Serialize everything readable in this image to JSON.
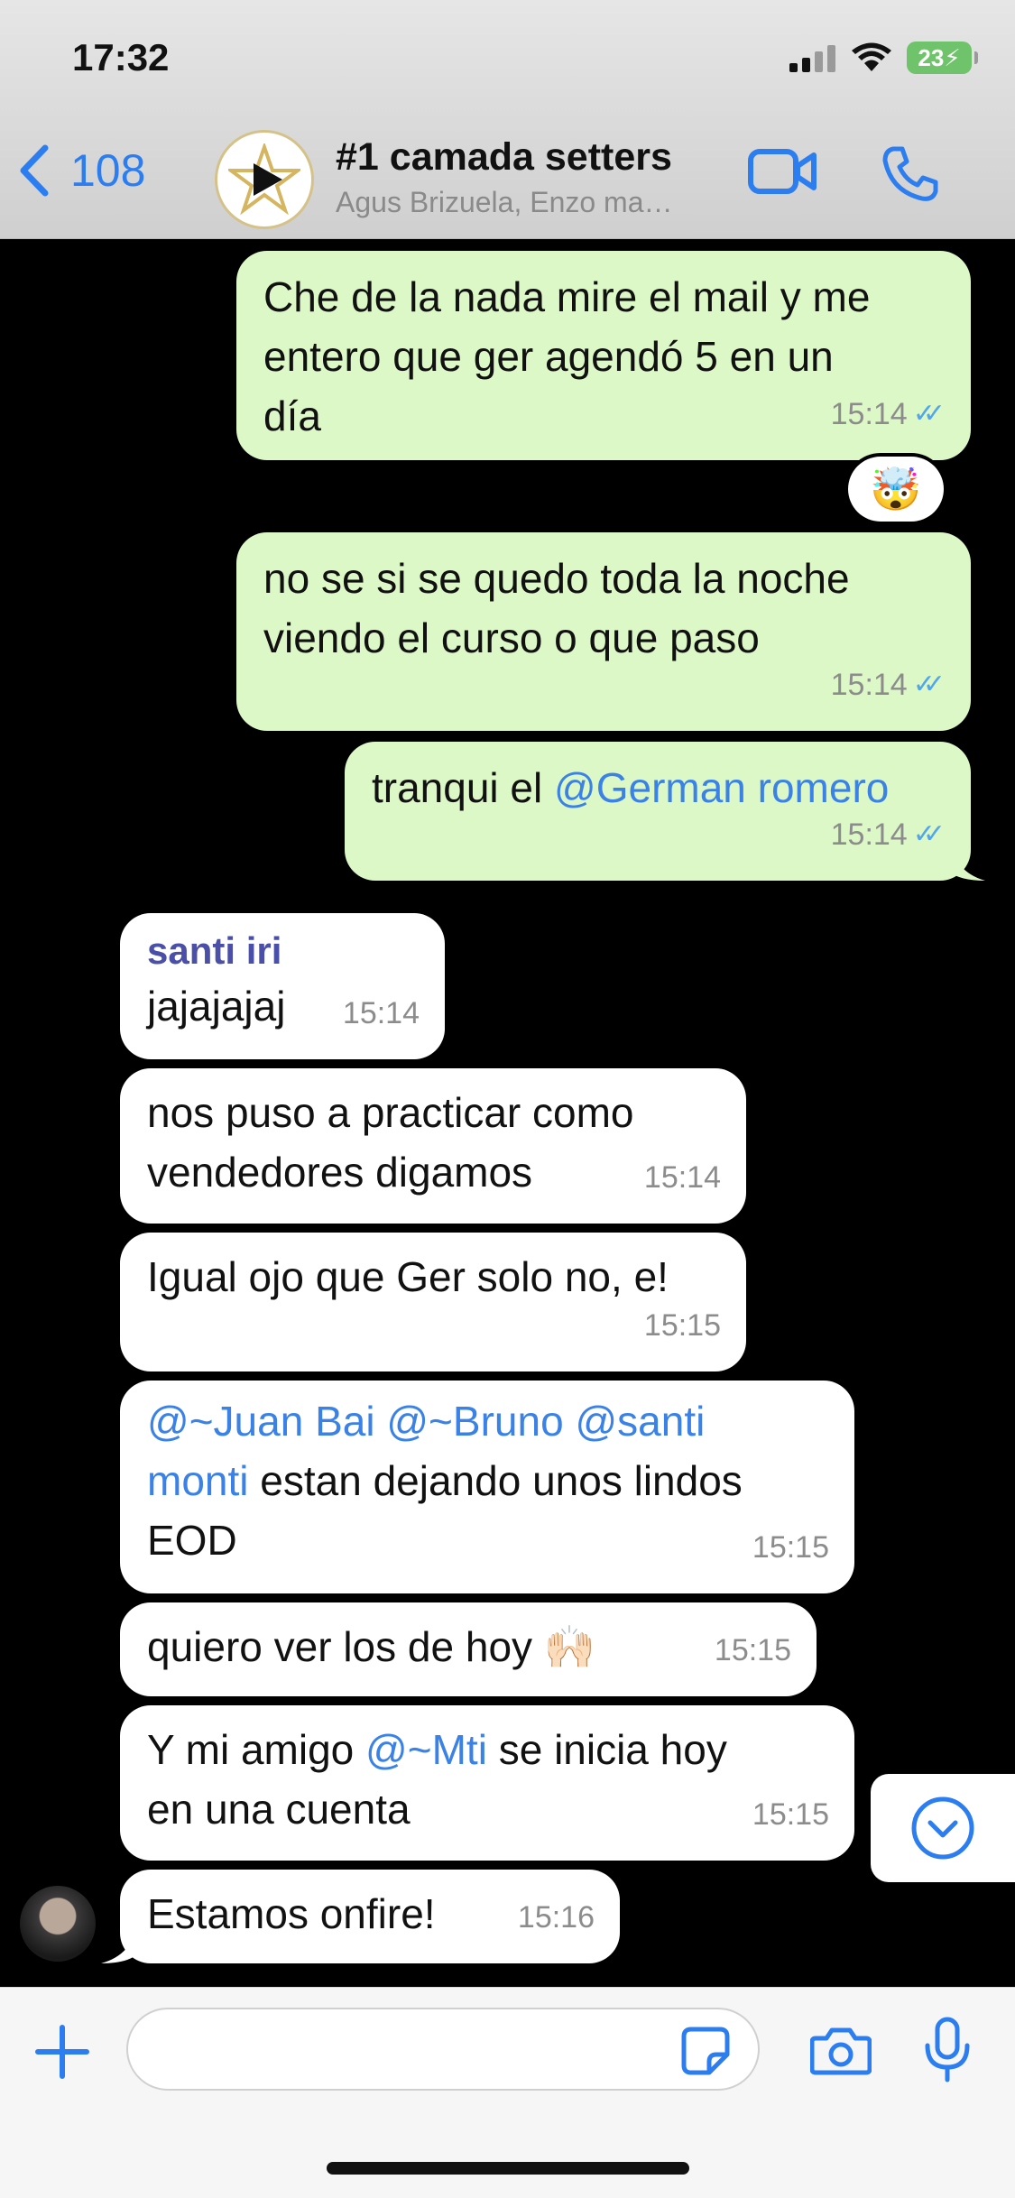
{
  "status": {
    "time": "17:32",
    "battery": "23"
  },
  "header": {
    "back_count": "108",
    "title": "#1 camada setters",
    "subtitle": "Agus Brizuela, Enzo ma…"
  },
  "messages": [
    {
      "text": "Che de la nada mire el mail y me\nentero que ger agendó 5 en un\ndía",
      "time": "15:14",
      "reaction": "🤯"
    },
    {
      "text": "no se si se quedo toda la noche\nviendo el curso o que paso",
      "time": "15:14"
    },
    {
      "text_before": "tranqui el ",
      "mention": "@German romero",
      "time": "15:14"
    },
    {
      "sender": "santi iri",
      "text": "jajajajaj",
      "time": "15:14"
    },
    {
      "text": "nos puso a practicar como\nvendedores digamos",
      "time": "15:14"
    },
    {
      "text": "Igual ojo que Ger solo no, e!",
      "time": "15:15"
    },
    {
      "m1": "@~Juan Bai",
      "m2": "@~Bruno",
      "m3a": "@santi",
      "m3b": "monti",
      "text_after": " estan dejando unos lindos",
      "text_line3": "EOD",
      "time": "15:15"
    },
    {
      "text": "quiero ver los de hoy 🙌🏻",
      "time": "15:15"
    },
    {
      "text_before": "Y mi amigo ",
      "mention": "@~Mti",
      "text_after": " se inicia hoy",
      "text_line2": "en una cuenta",
      "time": "15:15"
    },
    {
      "text": "Estamos onfire!",
      "time": "15:16"
    }
  ]
}
